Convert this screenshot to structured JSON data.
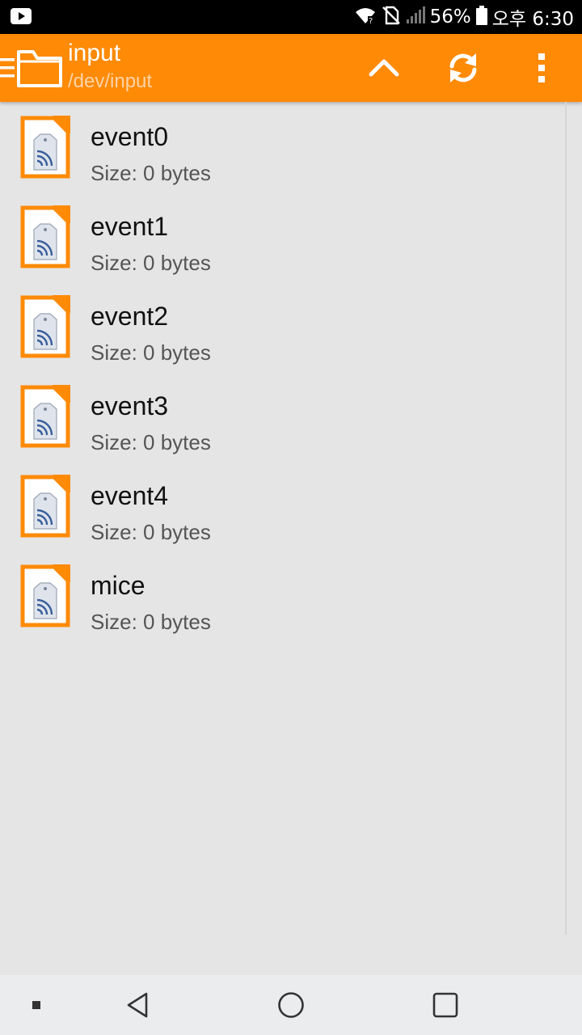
{
  "status_bar": {
    "battery_percent": "56%",
    "time": "오후 6:30",
    "icons": [
      "youtube-icon",
      "wifi-icon",
      "no-sim-icon",
      "signal-icon",
      "battery-icon"
    ]
  },
  "app_bar": {
    "title": "input",
    "path": "/dev/input",
    "color": "#fe8a06",
    "icons": [
      "menu-icon",
      "folder-icon",
      "up-arrow-icon",
      "refresh-icon",
      "more-vert-icon"
    ]
  },
  "files": [
    {
      "name": "event0",
      "size": "Size: 0 bytes"
    },
    {
      "name": "event1",
      "size": "Size: 0 bytes"
    },
    {
      "name": "event2",
      "size": "Size: 0 bytes"
    },
    {
      "name": "event3",
      "size": "Size: 0 bytes"
    },
    {
      "name": "event4",
      "size": "Size: 0 bytes"
    },
    {
      "name": "mice",
      "size": "Size: 0 bytes"
    }
  ],
  "nav_bar": {
    "icons": [
      "overview-dot-icon",
      "back-icon",
      "home-icon",
      "recents-icon"
    ]
  }
}
